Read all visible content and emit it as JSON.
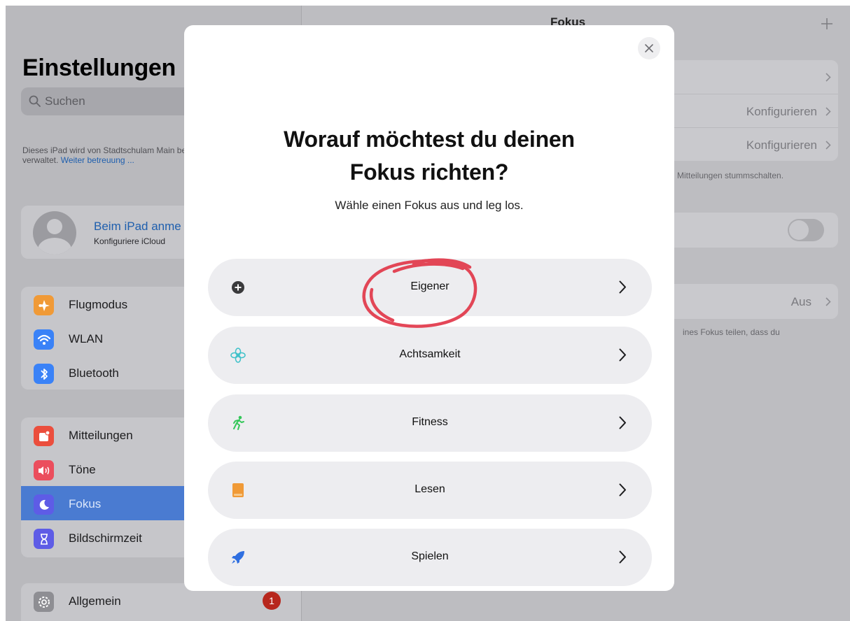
{
  "sidebar": {
    "title": "Einstellungen",
    "search_placeholder": "Suchen",
    "managed_text": "Dieses iPad wird von Stadtschulam Main betreut und verwaltet.",
    "managed_link": "Weiter betreuung ...",
    "account": {
      "title": "Beim iPad anme",
      "subtitle": "Konfiguriere iCloud"
    },
    "group1": [
      {
        "label": "Flugmodus",
        "icon": "airplane-icon",
        "color": "#f09a37"
      },
      {
        "label": "WLAN",
        "icon": "wifi-icon",
        "color": "#3a82f7"
      },
      {
        "label": "Bluetooth",
        "icon": "bluetooth-icon",
        "color": "#3a82f7"
      }
    ],
    "group2": [
      {
        "label": "Mitteilungen",
        "icon": "notifications-icon",
        "color": "#eb4e3d"
      },
      {
        "label": "Töne",
        "icon": "sounds-icon",
        "color": "#eb4e5d"
      },
      {
        "label": "Fokus",
        "icon": "moon-icon",
        "color": "#5e5ce6",
        "selected": true
      },
      {
        "label": "Bildschirmzeit",
        "icon": "hourglass-icon",
        "color": "#5e5ce6"
      }
    ],
    "group3": [
      {
        "label": "Allgemein",
        "icon": "gear-icon",
        "color": "#8e8e93",
        "badge": "1"
      }
    ]
  },
  "detail": {
    "title": "Fokus",
    "configure_1": "Konfigurieren",
    "configure_2": "Konfigurieren",
    "footer_1": "Mitteilungen stummschalten.",
    "status_value": "Aus",
    "footer_2": "ines Fokus teilen, dass du"
  },
  "modal": {
    "title_line1": "Worauf möchtest du deinen",
    "title_line2": "Fokus richten?",
    "subtitle": "Wähle einen Fokus aus und leg los.",
    "options": [
      {
        "label": "Eigener",
        "icon": "plus-circle-icon",
        "color": "#3a3a3c"
      },
      {
        "label": "Achtsamkeit",
        "icon": "flower-icon",
        "color": "#3ec1c9"
      },
      {
        "label": "Fitness",
        "icon": "running-icon",
        "color": "#34c759"
      },
      {
        "label": "Lesen",
        "icon": "book-icon",
        "color": "#f09a37"
      },
      {
        "label": "Spielen",
        "icon": "rocket-icon",
        "color": "#2f6fe0"
      }
    ],
    "annotation_color": "#e2384a"
  }
}
